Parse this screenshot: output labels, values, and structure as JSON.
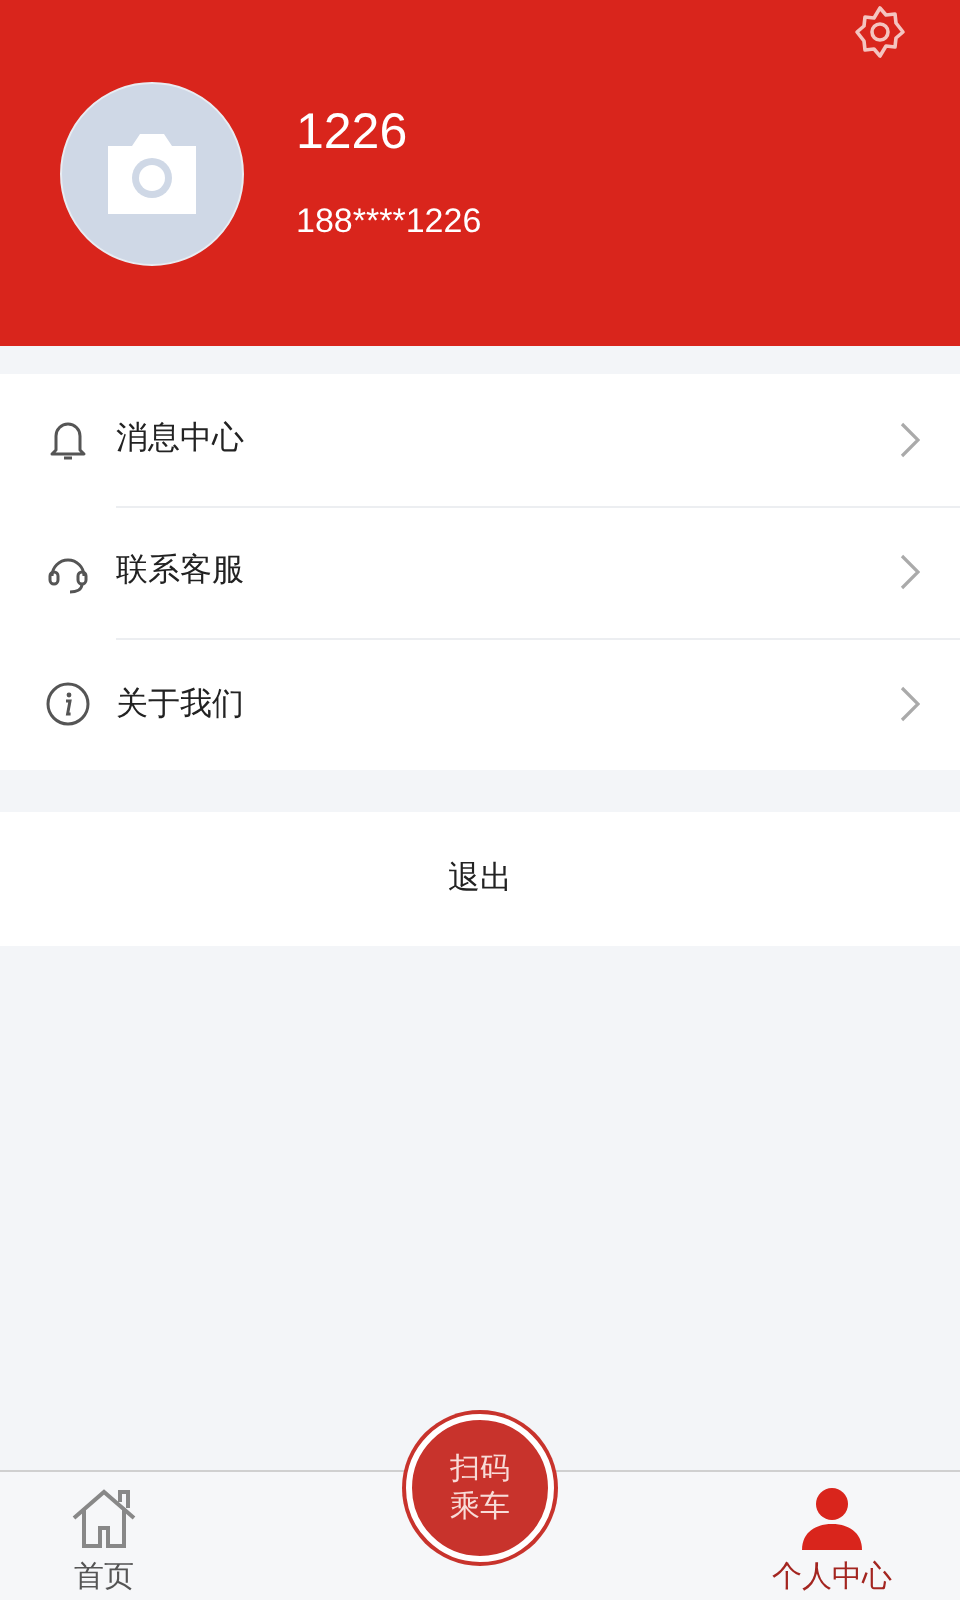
{
  "profile": {
    "name": "1226",
    "phone": "188****1226"
  },
  "menu": [
    {
      "kind": "bell",
      "label": "消息中心"
    },
    {
      "kind": "headset",
      "label": "联系客服"
    },
    {
      "kind": "info",
      "label": "关于我们"
    }
  ],
  "logout": "退出",
  "scan_button": {
    "line_1": "扫码",
    "line_2": "乘车"
  },
  "nav": [
    {
      "kind": "home",
      "label": "首页",
      "selected": false
    },
    {
      "kind": "person",
      "label": "个人中心",
      "selected": true
    }
  ]
}
